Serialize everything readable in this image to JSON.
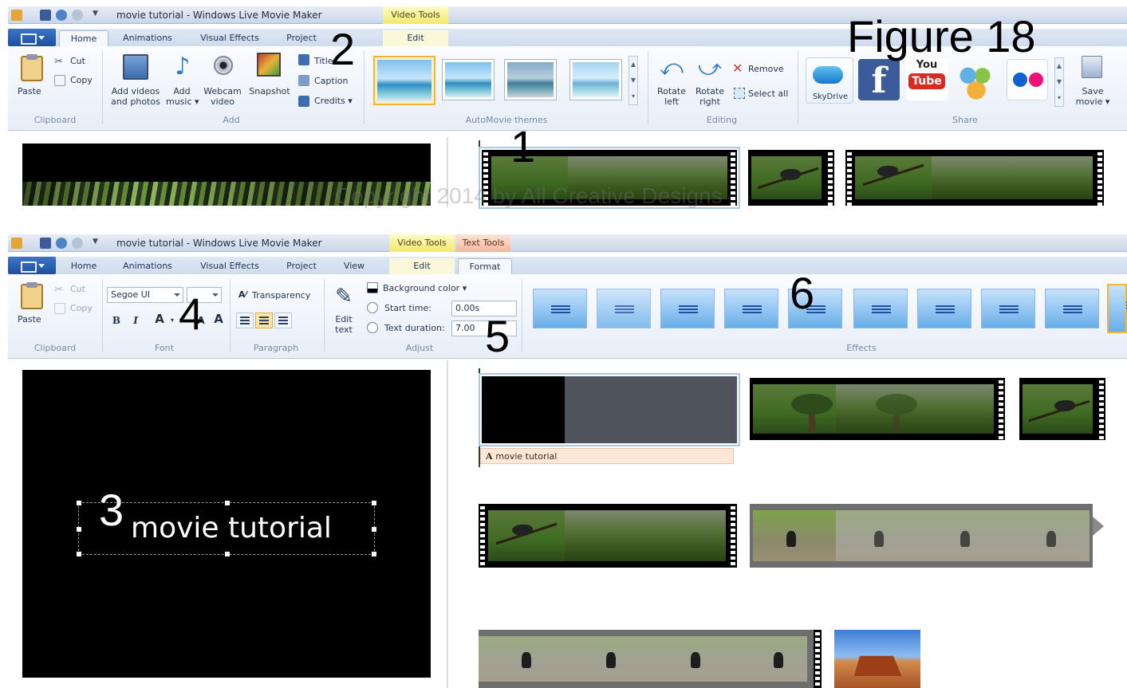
{
  "figure_label": "Figure 18",
  "watermark": "Copyright 2014 by All Creative Designs",
  "step_numbers": [
    "1",
    "2",
    "3",
    "4",
    "5",
    "6"
  ],
  "top": {
    "window_title": "movie tutorial - Windows Live Movie Maker",
    "contextual_tab": "Video Tools",
    "tabs": [
      "Home",
      "Animations",
      "Visual Effects",
      "Project"
    ],
    "contextual_subtab": "Edit",
    "active_tab": "Home",
    "clipboard": {
      "paste": "Paste",
      "cut": "Cut",
      "copy": "Copy",
      "label": "Clipboard"
    },
    "add": {
      "add_videos": "Add videos",
      "and_photos": "and photos",
      "add": "Add",
      "music": "music",
      "webcam": "Webcam",
      "video": "video",
      "snapshot": "Snapshot",
      "title": "Title",
      "caption": "Caption",
      "credits": "Credits",
      "label": "Add"
    },
    "themes_label": "AutoMovie themes",
    "editing": {
      "rotate_left_1": "Rotate",
      "rotate_left_2": "left",
      "rotate_right_1": "Rotate",
      "rotate_right_2": "right",
      "remove": "Remove",
      "select_all": "Select all",
      "label": "Editing"
    },
    "share": {
      "skydrive": "SkyDrive",
      "youtube_you": "You",
      "youtube_tube": "Tube",
      "save_movie_1": "Save",
      "save_movie_2": "movie",
      "label": "Share"
    }
  },
  "bottom": {
    "window_title": "movie tutorial - Windows Live Movie Maker",
    "contextual_tab_video": "Video Tools",
    "contextual_tab_text": "Text Tools",
    "tabs": [
      "Home",
      "Animations",
      "Visual Effects",
      "Project",
      "View"
    ],
    "subtab_edit": "Edit",
    "subtab_format": "Format",
    "active_tab": "Format",
    "clipboard": {
      "paste": "Paste",
      "cut": "Cut",
      "copy": "Copy",
      "label": "Clipboard"
    },
    "font": {
      "family": "Segoe UI",
      "bold": "B",
      "italic": "I",
      "color": "A",
      "label": "Font"
    },
    "paragraph": {
      "transparency": "Transparency",
      "label": "Paragraph"
    },
    "adjust": {
      "edit_text_1": "Edit",
      "edit_text_2": "text",
      "background_color": "Background color",
      "start_time_label": "Start time:",
      "start_time_value": "0.00s",
      "text_duration_label": "Text duration:",
      "text_duration_value": "7.00",
      "label": "Adjust"
    },
    "effects_label": "Effects",
    "caption_track": "movie tutorial",
    "preview_text": "movie tutorial"
  },
  "colors": {
    "ribbon_blue": "#1f4f9e",
    "video_tools": "#f3e86c",
    "text_tools": "#f4b69b",
    "selection": "#f2b437"
  }
}
